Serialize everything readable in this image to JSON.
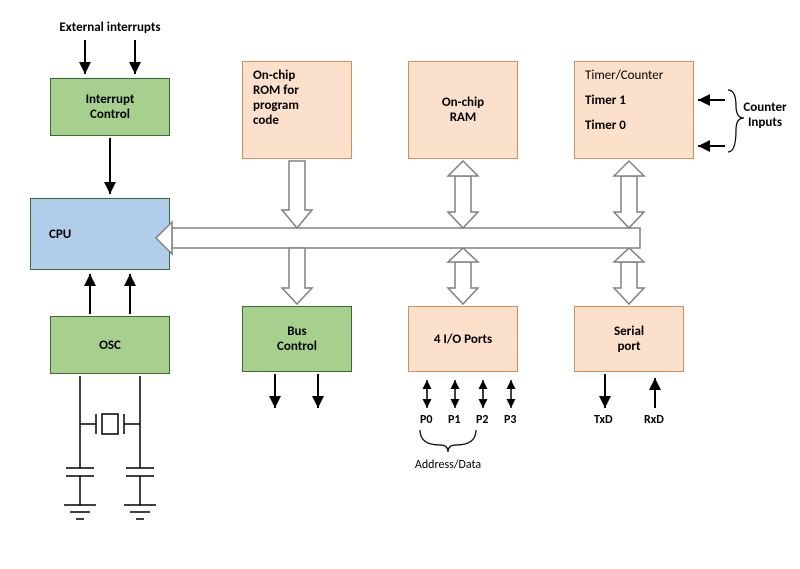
{
  "title_ext_int": "External interrupts",
  "blocks": {
    "interrupt_control": "Interrupt\nControl",
    "cpu": "CPU",
    "osc": "OSC",
    "rom": "On-chip\nROM for\nprogram\ncode",
    "ram": "On-chip\nRAM",
    "timer_header": "Timer/Counter",
    "timer1": "Timer 1",
    "timer0": "Timer 0",
    "bus_control": "Bus\nControl",
    "io_ports": "4 I/O Ports",
    "serial_port": "Serial\nport"
  },
  "labels": {
    "counter_inputs": "Counter\nInputs",
    "p0": "P0",
    "p1": "P1",
    "p2": "P2",
    "p3": "P3",
    "addr_data": "Address/Data",
    "txd": "TxD",
    "rxd": "RxD"
  }
}
